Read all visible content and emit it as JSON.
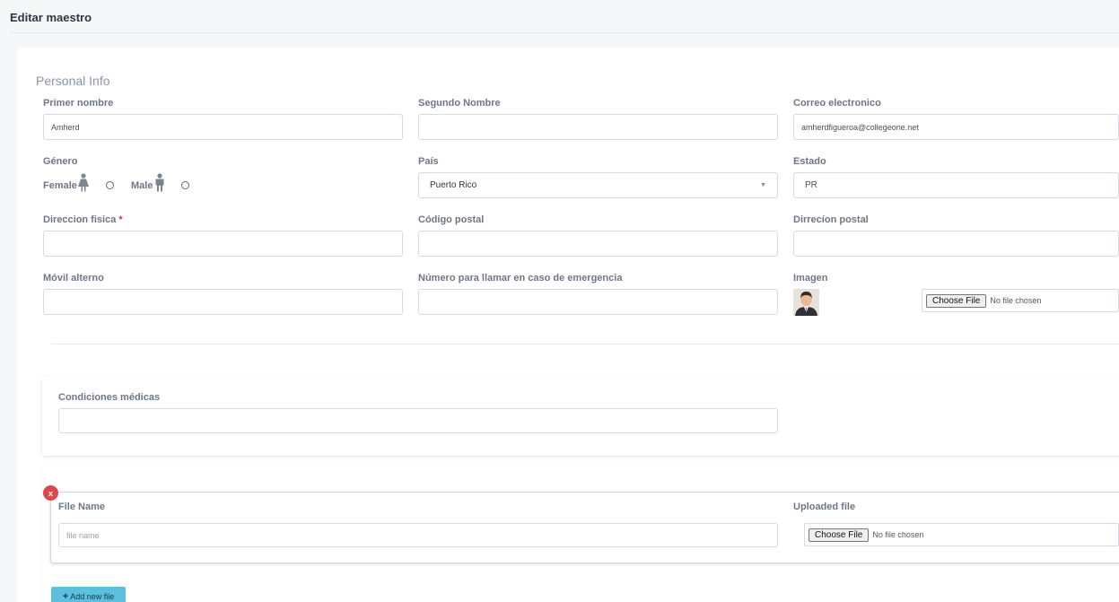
{
  "page": {
    "title": "Editar maestro"
  },
  "personal_info": {
    "section_title": "Personal Info",
    "first_name": {
      "label": "Primer nombre",
      "value": "Amherd"
    },
    "second_name": {
      "label": "Segundo Nombre",
      "value": ""
    },
    "email": {
      "label": "Correo electronico",
      "value": "amherdfigueroa@collegeone.net"
    },
    "gender": {
      "label": "Género",
      "female_label": "Female",
      "male_label": "Male"
    },
    "country": {
      "label": "País",
      "value": "Puerto Rico"
    },
    "state": {
      "label": "Estado",
      "value": "PR"
    },
    "physical_address": {
      "label": "Direccion fisica",
      "required_mark": "*",
      "value": ""
    },
    "postal_code": {
      "label": "Código postal",
      "value": ""
    },
    "postal_address": {
      "label": "Dirrecíon postal",
      "value": ""
    },
    "alt_mobile": {
      "label": "Móvil alterno",
      "value": ""
    },
    "emergency_phone": {
      "label": "Número para llamar en caso de emergencia",
      "value": ""
    },
    "image": {
      "label": "Imagen",
      "choose_label": "Choose File",
      "status": "No file chosen"
    }
  },
  "medical": {
    "label": "Condiciones médicas",
    "value": ""
  },
  "files": {
    "remove_label": "x",
    "file_name_label": "File Name",
    "file_name_placeholder": "file name",
    "uploaded_label": "Uploaded file",
    "choose_label": "Choose File",
    "status": "No file chosen",
    "add_label": "Add new file"
  },
  "colors": {
    "accent": "#5bc0de",
    "danger": "#e0474c",
    "required": "#e3342f"
  }
}
